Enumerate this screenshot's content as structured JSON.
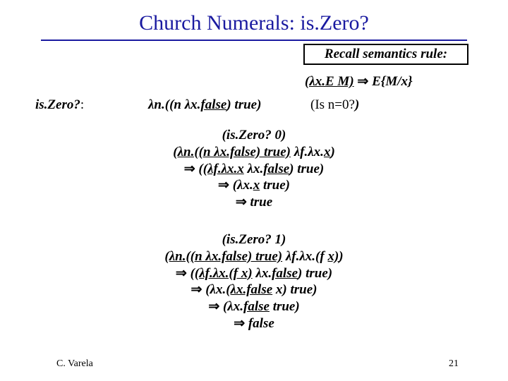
{
  "title": "Church Numerals: is.Zero?",
  "recall": "Recall semantics rule:",
  "rule_lhs": "(λx.E M)",
  "rule_arrow": " ⇒ ",
  "rule_rhs": "E{M/x}",
  "iszero_label": "is.Zero?",
  "colon": ":",
  "iszero_def_pre": "λn.((n λx.",
  "iszero_def_u": "false",
  "iszero_def_post": ") true)",
  "iszero_comment_pre": "(Is n=0?",
  "iszero_comment_paren": ")",
  "b0": {
    "l1": "(is.Zero? 0)",
    "l2a": "(",
    "l2u": "λn.((n λx.false) true)",
    "l2b": " λf.λx.",
    "l2u2": "x",
    "l2c": ")",
    "l3arrow": "⇒ ",
    "l3a": "((",
    "l3u": "λf.λx.x",
    "l3b": " λx.",
    "l3u2": "false",
    "l3c": ") true)",
    "l4arrow": "⇒ ",
    "l4a": "(λx.",
    "l4u": "x",
    "l4b": " true)",
    "l5arrow": "⇒ ",
    "l5": "true"
  },
  "b1": {
    "l1": "(is.Zero? 1)",
    "l2a": "(",
    "l2u": "λn.((n λx.false) true)",
    "l2b": " λf.λx.(f ",
    "l2u2": "x)",
    "l2c": ")",
    "l3arrow": "⇒ ",
    "l3a": "((",
    "l3u": "λf.λx.(f x)",
    "l3b": " λx.",
    "l3u2": "false",
    "l3c": ") true)",
    "l4arrow": "⇒ ",
    "l4a": "(λx.(",
    "l4u": "λx.false",
    "l4b": " x) true)",
    "l5arrow": "⇒ ",
    "l5a": "(λx.",
    "l5u": "false",
    "l5b": " true)",
    "l6arrow": "⇒ ",
    "l6": "false"
  },
  "footer_author": "C. Varela",
  "footer_page": "21"
}
